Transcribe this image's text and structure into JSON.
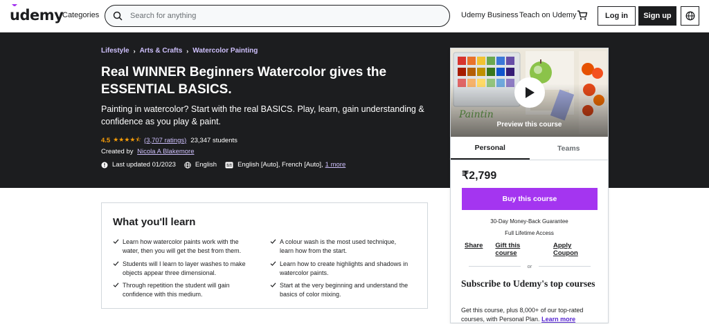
{
  "header": {
    "logo": "udemy",
    "categories": "Categories",
    "search_placeholder": "Search for anything",
    "business": "Udemy Business",
    "teach": "Teach on Udemy",
    "login": "Log in",
    "signup": "Sign up"
  },
  "breadcrumbs": [
    "Lifestyle",
    "Arts & Crafts",
    "Watercolor Painting"
  ],
  "course": {
    "title": "Real WINNER Beginners Watercolor gives the ESSENTIAL BASICS.",
    "subtitle": "Painting in watercolor? Start with the real BASICS. Play, learn, gain understanding & confidence as you play & paint.",
    "rating": "4.5",
    "rating_value": 4.5,
    "stars": "★★★★⯪",
    "ratings_count": "(3,707 ratings)",
    "students": "23,347 students",
    "created_by": "Created by",
    "author": "Nicola A Blakemore",
    "last_updated": "Last updated 01/2023",
    "language": "English",
    "captions": "English [Auto], French [Auto],",
    "more": "1 more"
  },
  "card": {
    "preview_label": "Preview this course",
    "tabs": [
      "Personal",
      "Teams"
    ],
    "price": "₹2,799",
    "buy": "Buy this course",
    "guarantee": "30-Day Money-Back Guarantee",
    "lifetime": "Full Lifetime Access",
    "share": "Share",
    "gift": "Gift this course",
    "coupon": "Apply Coupon",
    "or": "or",
    "subscribe_title": "Subscribe to Udemy's top courses",
    "subscribe_desc": "Get this course, plus 8,000+ of our top-rated courses, with Personal Plan.",
    "learn_more": "Learn more"
  },
  "learn": {
    "title": "What you'll learn",
    "items": [
      "Learn how watercolor paints work with the water, then you will get the best from them.",
      "A colour wash is the most used technique, learn how from the start.",
      "Students will I learn to layer washes to make objects appear three dimensional.",
      "Learn how to create highlights and shadows in watercolor paints.",
      "Through repetition the student will gain confidence with this medium.",
      "Start at the very beginning and understand the basics of color mixing."
    ]
  },
  "colors": {
    "brand_purple": "#a435f0",
    "hero_bg": "#1c1d1f",
    "link_light": "#cec0fc",
    "star": "#f69c08"
  }
}
